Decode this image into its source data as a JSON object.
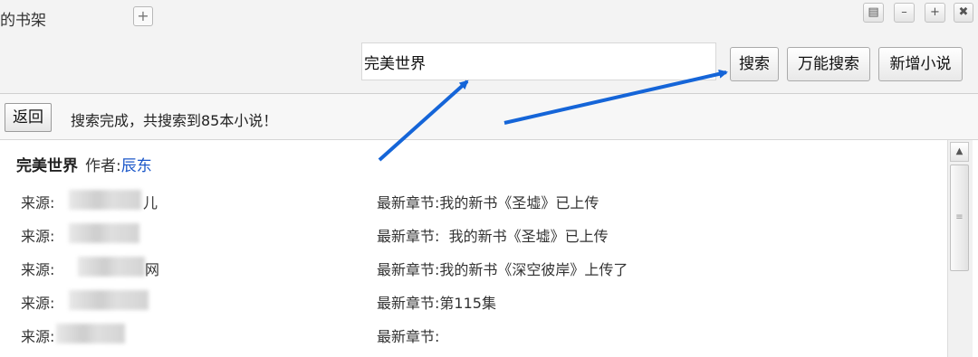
{
  "header": {
    "shelf_tab": "的书架",
    "tab_add_glyph": "+",
    "window_buttons": [
      "▤",
      "–",
      "+",
      "✖"
    ]
  },
  "search": {
    "query": "完美世界",
    "buttons": {
      "search": "搜索",
      "universal_search": "万能搜索",
      "add_novel": "新增小说"
    }
  },
  "status": {
    "back_label": "返回",
    "message": "搜索完成，共搜索到85本小说！"
  },
  "result": {
    "title": "完美世界",
    "author_label": "作者:",
    "author": "辰东",
    "source_label": "来源:",
    "chapter_label": "最新章节:",
    "rows": [
      {
        "source_suffix": "儿",
        "chapter": "我的新书《圣墟》已上传"
      },
      {
        "source_suffix": "",
        "chapter": "  我的新书《圣墟》已上传"
      },
      {
        "source_suffix": "网",
        "chapter": "我的新书《深空彼岸》上传了"
      },
      {
        "source_suffix": "",
        "chapter": "第115集"
      },
      {
        "source_suffix": "",
        "chapter": ""
      }
    ]
  },
  "colors": {
    "annotation_arrow": "#1565d8",
    "author_link": "#1a56c9"
  }
}
